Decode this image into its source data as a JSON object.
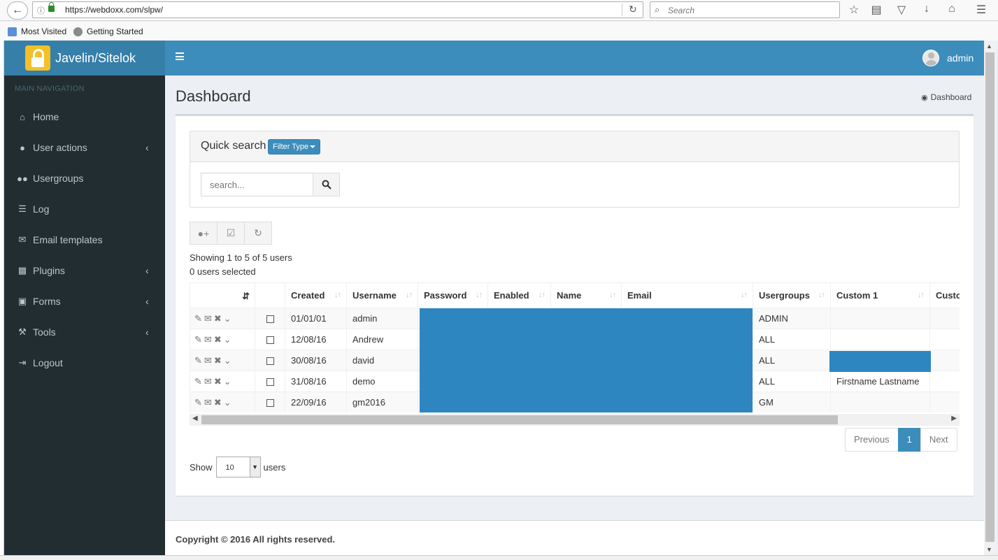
{
  "browser": {
    "url": "https://webdoxx.com/slpw/",
    "search_placeholder": "Search",
    "bookmarks": [
      "Most Visited",
      "Getting Started"
    ]
  },
  "app": {
    "brand": "Javelin/Sitelok",
    "user": "admin"
  },
  "sidebar": {
    "header": "MAIN NAVIGATION",
    "items": [
      {
        "label": "Home",
        "icon": "home-icon",
        "submenu": false
      },
      {
        "label": "User actions",
        "icon": "user-icon",
        "submenu": true
      },
      {
        "label": "Usergroups",
        "icon": "users-icon",
        "submenu": false
      },
      {
        "label": "Log",
        "icon": "list-icon",
        "submenu": false
      },
      {
        "label": "Email templates",
        "icon": "envelope-icon",
        "submenu": false
      },
      {
        "label": "Plugins",
        "icon": "puzzle-icon",
        "submenu": true
      },
      {
        "label": "Forms",
        "icon": "form-icon",
        "submenu": true
      },
      {
        "label": "Tools",
        "icon": "wrench-icon",
        "submenu": true
      },
      {
        "label": "Logout",
        "icon": "sign-out-icon",
        "submenu": false
      }
    ]
  },
  "page": {
    "title": "Dashboard",
    "breadcrumb": "Dashboard"
  },
  "quick_search": {
    "title": "Quick search",
    "filter_label": "Filter Type",
    "placeholder": "search..."
  },
  "status": {
    "showing": "Showing 1 to 5 of 5 users",
    "selected": "0 users selected"
  },
  "table": {
    "columns": [
      "Created",
      "Username",
      "Password",
      "Enabled",
      "Name",
      "Email",
      "Usergroups",
      "Custom 1",
      "Custo"
    ],
    "rows": [
      {
        "created": "01/01/01",
        "username": "admin",
        "usergroups": "ADMIN",
        "custom1": ""
      },
      {
        "created": "12/08/16",
        "username": "Andrew",
        "usergroups": "ALL",
        "custom1": ""
      },
      {
        "created": "30/08/16",
        "username": "david",
        "usergroups": "ALL",
        "custom1": ""
      },
      {
        "created": "31/08/16",
        "username": "demo",
        "usergroups": "ALL",
        "custom1": "Firstname Lastname"
      },
      {
        "created": "22/09/16",
        "username": "gm2016",
        "usergroups": "GM",
        "custom1": ""
      }
    ]
  },
  "pagination": {
    "previous": "Previous",
    "current": "1",
    "next": "Next"
  },
  "page_size": {
    "show_label": "Show",
    "value": "10",
    "suffix": "users"
  },
  "footer": {
    "text": "Copyright © 2016 All rights reserved."
  },
  "colors": {
    "brand": "#367fa9",
    "navbar": "#3c8dbc",
    "sidebar": "#222d32",
    "redaction": "#2e86c1"
  }
}
